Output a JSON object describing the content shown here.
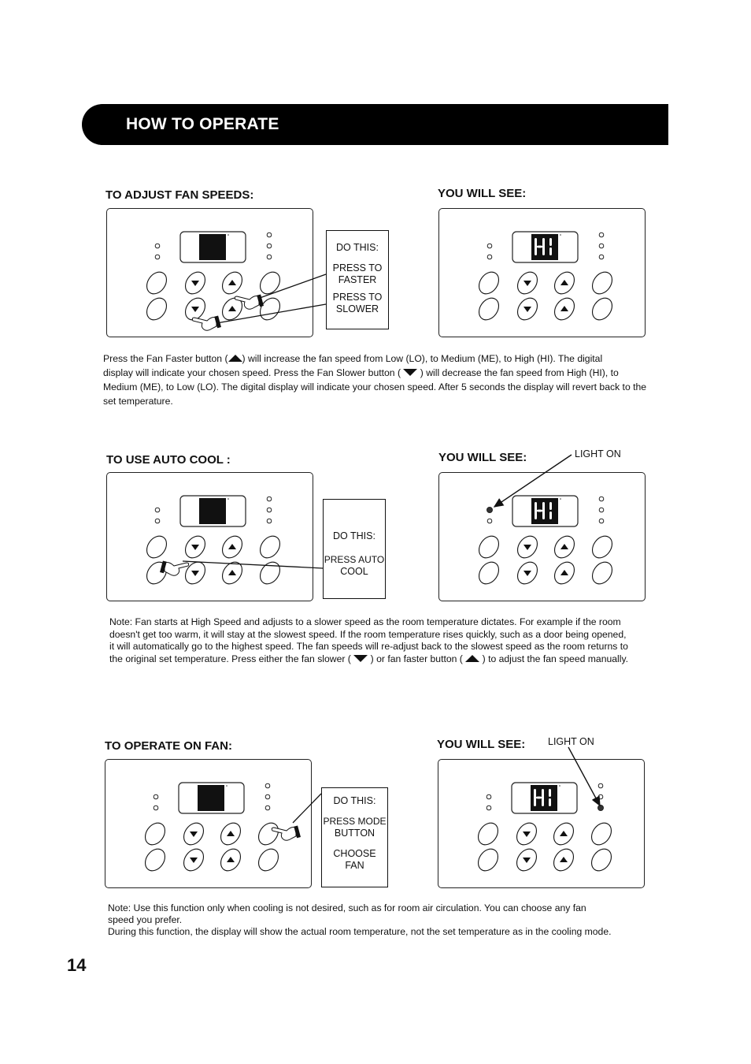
{
  "header": {
    "title": "HOW TO OPERATE"
  },
  "sections": [
    {
      "id": "fan-speeds",
      "heading": "TO ADJUST FAN SPEEDS:",
      "result_heading": "YOU WILL SEE:",
      "instruction_box": [
        "DO THIS:",
        "PRESS TO",
        "FASTER",
        "PRESS TO",
        "SLOWER"
      ],
      "display_before": "",
      "display_after": "HI",
      "paragraph": {
        "rows": [
          [
            "Press the Fan Faster button (",
            "up-triangle-icon",
            ") will increase the fan speed  from Low (LO), to Medium (ME), to High (HI). The digital"
          ],
          [
            "display will indicate your chosen speed. Press the Fan Slower  button ( ",
            "down-triangle-icon",
            " ) will decrease the fan speed from High (HI), to"
          ],
          [
            "Medium (ME), to Low (LO). The digital display will indicate your chosen speed.  After 5 seconds the display will revert back to the"
          ],
          [
            "set temperature."
          ]
        ]
      }
    },
    {
      "id": "auto-cool",
      "heading": "TO USE AUTO COOL :",
      "result_heading": "YOU WILL SEE:",
      "callout": "LIGHT ON",
      "instruction_box": [
        "DO THIS:",
        "PRESS AUTO",
        "COOL"
      ],
      "display_before": "",
      "display_after": "HI",
      "paragraph": {
        "rows": [
          [
            "Note:  Fan starts at High Speed and adjusts to a slower speed as the room temperature dictates. For example if the room"
          ],
          [
            "doesn't get too warm, it will stay at the slowest speed. If the room temperature rises quickly, such as a door being opened,"
          ],
          [
            "it will automatically go to  the  highest speed. The fan speeds will re-adjust back to the slowest speed as the room returns to"
          ],
          [
            "the original set temperature. Press either the fan slower ( ",
            "down-triangle-icon",
            " )  or fan faster button ( ",
            "up-triangle-icon",
            " )  to adjust the fan speed manually."
          ]
        ]
      }
    },
    {
      "id": "fan-mode",
      "heading": "TO OPERATE ON FAN:",
      "result_heading": "YOU WILL SEE:",
      "callout": "LIGHT ON",
      "instruction_box": [
        "DO THIS:",
        "PRESS MODE",
        "BUTTON",
        "CHOOSE",
        "FAN"
      ],
      "display_before": "",
      "display_after": "HI",
      "paragraph": {
        "rows": [
          [
            "Note:   Use this function only when cooling is not desired, such  as for room air circulation. You can choose any fan"
          ],
          [
            "speed you prefer."
          ],
          [
            "During this function, the display will show the actual room temperature, not the set temperature as in the cooling mode."
          ]
        ]
      }
    }
  ],
  "footer": {
    "page_number": "14"
  }
}
